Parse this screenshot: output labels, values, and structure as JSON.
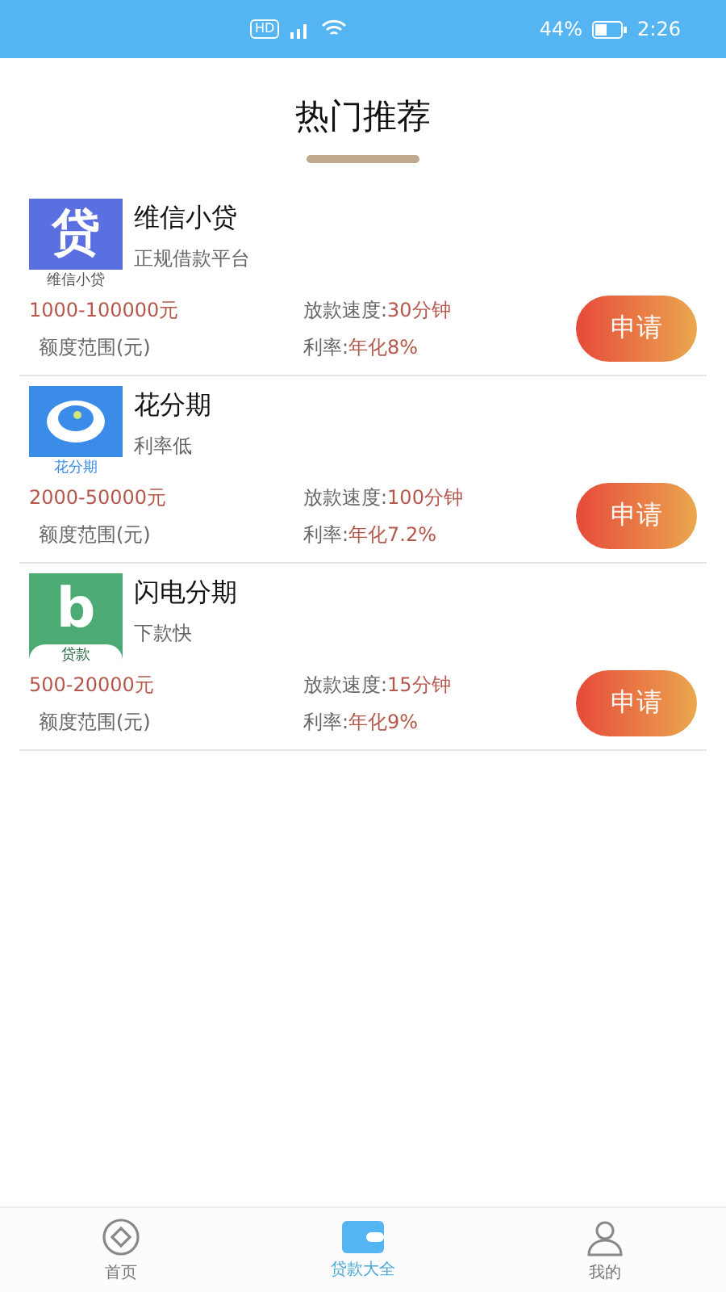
{
  "status_bar": {
    "hd": "HD",
    "battery": "44%",
    "time": "2:26"
  },
  "title": "热门推荐",
  "loans": [
    {
      "logo": {
        "kind": "glyph",
        "glyph": "贷",
        "caption": "维信小贷",
        "color": "#5a6fe0"
      },
      "name": "维信小贷",
      "tagline": "正规借款平台",
      "amount": "1000-100000元",
      "amount_label": "额度范围(元)",
      "speed_label": "放款速度:",
      "speed": "30分钟",
      "rate_label": "利率:",
      "rate": "年化8%",
      "button": "申请"
    },
    {
      "logo": {
        "kind": "eye",
        "caption": "花分期",
        "color": "#3a8ce8"
      },
      "name": "花分期",
      "tagline": "利率低",
      "amount": "2000-50000元",
      "amount_label": "额度范围(元)",
      "speed_label": "放款速度:",
      "speed": "100分钟",
      "rate_label": "利率:",
      "rate": "年化7.2%",
      "button": "申请"
    },
    {
      "logo": {
        "kind": "sprout",
        "glyph": "b",
        "caption": "贷款",
        "color": "#4caa74"
      },
      "name": "闪电分期",
      "tagline": "下款快",
      "amount": "500-20000元",
      "amount_label": "额度范围(元)",
      "speed_label": "放款速度:",
      "speed": "15分钟",
      "rate_label": "利率:",
      "rate": "年化9%",
      "button": "申请"
    }
  ],
  "nav": [
    {
      "kind": "home",
      "label": "首页",
      "selected": false
    },
    {
      "kind": "wallet",
      "label": "贷款大全",
      "selected": true
    },
    {
      "kind": "user",
      "label": "我的",
      "selected": false
    }
  ]
}
